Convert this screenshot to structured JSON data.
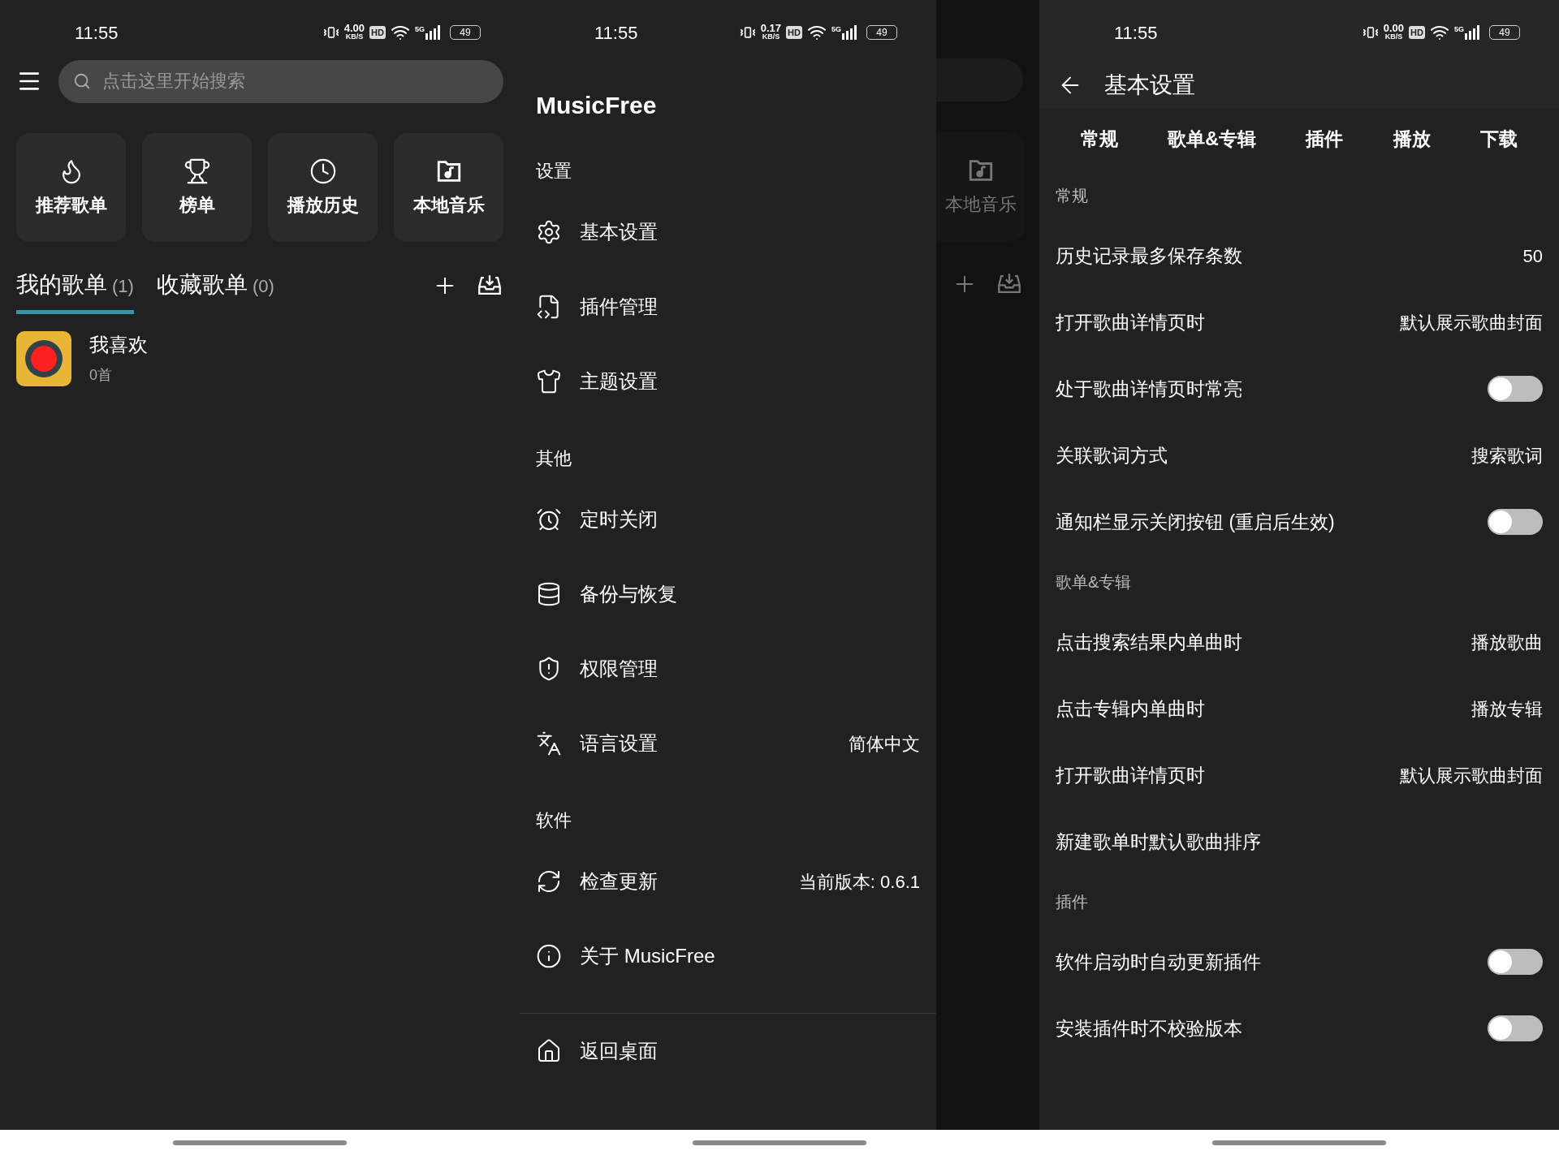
{
  "home": {
    "status_bar": {
      "time": "11:55",
      "speed": "4.00",
      "speed_unit": "KB/S",
      "hd": "HD",
      "network": "5G",
      "battery": "49"
    },
    "search": {
      "placeholder": "点击这里开始搜索"
    },
    "shortcuts": [
      {
        "label": "推荐歌单"
      },
      {
        "label": "榜单"
      },
      {
        "label": "播放历史"
      },
      {
        "label": "本地音乐"
      }
    ],
    "tabs": [
      {
        "label": "我的歌单",
        "count": "(1)",
        "selected": true
      },
      {
        "label": "收藏歌单",
        "count": "(0)",
        "selected": false
      }
    ],
    "playlists": [
      {
        "name": "我喜欢",
        "count": "0首"
      }
    ]
  },
  "drawer": {
    "status_bar": {
      "time": "11:55",
      "speed": "0.17",
      "speed_unit": "KB/S",
      "hd": "HD",
      "network": "5G",
      "battery": "49"
    },
    "title": "MusicFree",
    "sections": [
      {
        "heading": "设置",
        "items": [
          {
            "label": "基本设置"
          },
          {
            "label": "插件管理"
          },
          {
            "label": "主题设置"
          }
        ]
      },
      {
        "heading": "其他",
        "items": [
          {
            "label": "定时关闭"
          },
          {
            "label": "备份与恢复"
          },
          {
            "label": "权限管理"
          },
          {
            "label": "语言设置",
            "value": "简体中文"
          }
        ]
      },
      {
        "heading": "软件",
        "items": [
          {
            "label": "检查更新",
            "value": "当前版本: 0.6.1"
          },
          {
            "label": "关于 MusicFree"
          }
        ]
      }
    ],
    "footer_items": [
      {
        "label": "返回桌面"
      }
    ],
    "behind": {
      "shortcut_label": "本地音乐"
    }
  },
  "settings": {
    "status_bar": {
      "time": "11:55",
      "speed": "0.00",
      "speed_unit": "KB/S",
      "hd": "HD",
      "network": "5G",
      "battery": "49"
    },
    "title": "基本设置",
    "tabs": [
      {
        "label": "常规"
      },
      {
        "label": "歌单&专辑"
      },
      {
        "label": "插件"
      },
      {
        "label": "播放"
      },
      {
        "label": "下载"
      }
    ],
    "sections": [
      {
        "heading": "常规",
        "rows": [
          {
            "kind": "value",
            "label": "历史记录最多保存条数",
            "value": "50"
          },
          {
            "kind": "value",
            "label": "打开歌曲详情页时",
            "value": "默认展示歌曲封面"
          },
          {
            "kind": "toggle",
            "label": "处于歌曲详情页时常亮",
            "on": false
          },
          {
            "kind": "value",
            "label": "关联歌词方式",
            "value": "搜索歌词"
          },
          {
            "kind": "toggle",
            "label": "通知栏显示关闭按钮 (重启后生效)",
            "on": false
          }
        ]
      },
      {
        "heading": "歌单&专辑",
        "rows": [
          {
            "kind": "value",
            "label": "点击搜索结果内单曲时",
            "value": "播放歌曲"
          },
          {
            "kind": "value",
            "label": "点击专辑内单曲时",
            "value": "播放专辑"
          },
          {
            "kind": "value",
            "label": "打开歌曲详情页时",
            "value": "默认展示歌曲封面"
          },
          {
            "kind": "plain",
            "label": "新建歌单时默认歌曲排序"
          }
        ]
      },
      {
        "heading": "插件",
        "rows": [
          {
            "kind": "toggle",
            "label": "软件启动时自动更新插件",
            "on": false
          },
          {
            "kind": "toggle",
            "label": "安装插件时不校验版本",
            "on": false
          }
        ]
      }
    ]
  }
}
